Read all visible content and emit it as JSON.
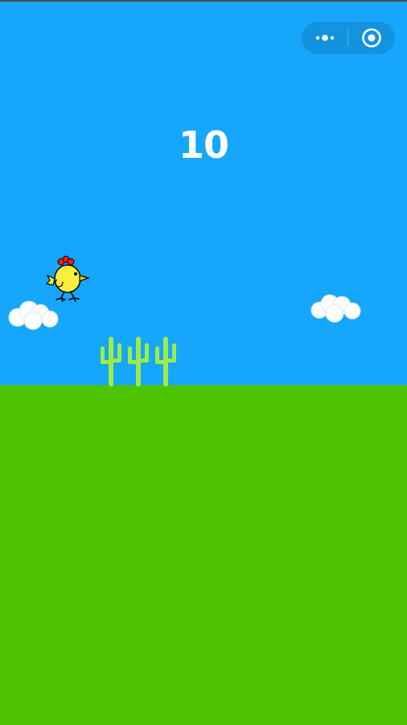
{
  "game": {
    "score": "10",
    "colors": {
      "sky": "#16a7fd",
      "ground": "#4cc200",
      "cactus": "#9ceb4a",
      "chicken_body": "#fbef3b",
      "chicken_comb": "#e8201c",
      "cloud": "#ffffff"
    }
  },
  "capsule": {
    "more_icon": "more-dots-icon",
    "close_icon": "target-circle-icon"
  },
  "sprites": {
    "player": "chicken",
    "obstacle": "cactus",
    "obstacle_count": 3,
    "decor": [
      "cloud",
      "cloud"
    ]
  }
}
